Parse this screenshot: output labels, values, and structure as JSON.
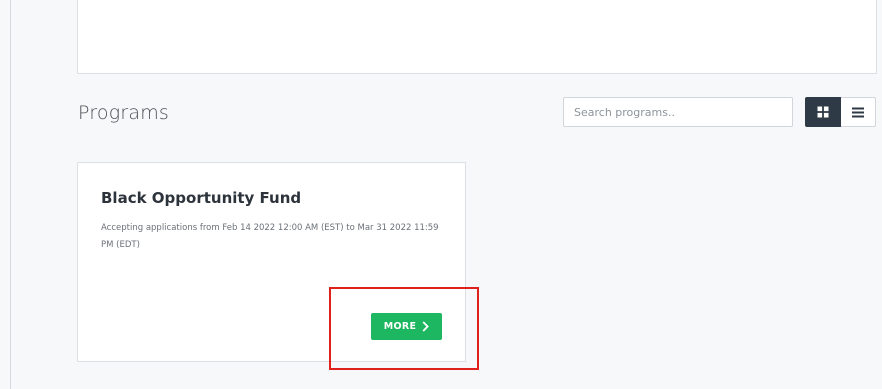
{
  "section": {
    "title": "Programs"
  },
  "search": {
    "placeholder": "Search programs.."
  },
  "view_toggle": {
    "active": "grid",
    "icons": [
      "grid-icon",
      "list-icon"
    ]
  },
  "programs": [
    {
      "name": "Black Opportunity Fund",
      "description": "Accepting applications from Feb 14 2022 12:00 AM (EST) to Mar 31 2022 11:59 PM (EDT)",
      "button_label": "MORE",
      "button_icon": "chevron-right-icon"
    }
  ],
  "colors": {
    "accent_button": "#1db761",
    "active_toggle": "#2e3a45",
    "highlight": "#e0201b"
  }
}
